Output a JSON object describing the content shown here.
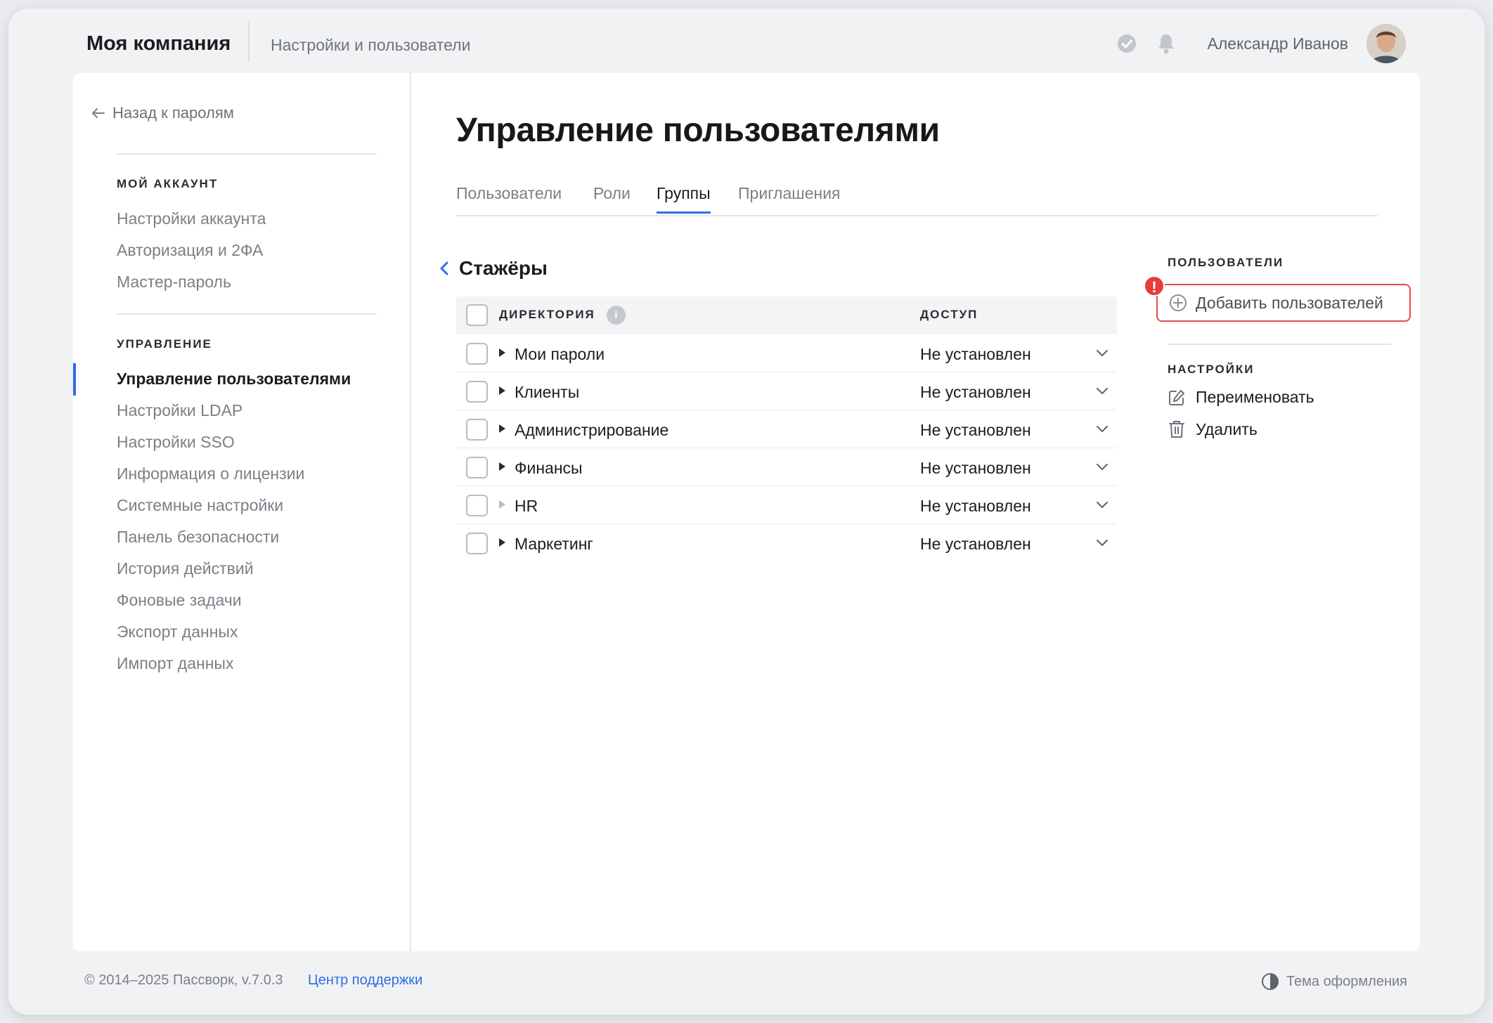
{
  "header": {
    "brand": "Моя компания",
    "subtitle": "Настройки и пользователи",
    "user_name": "Александр Иванов",
    "icons": [
      "check-circle-icon",
      "bell-icon"
    ]
  },
  "sidebar": {
    "back_label": "Назад к паролям",
    "section_account": "МОЙ АККАУНТ",
    "account_items": [
      "Настройки аккаунта",
      "Авторизация и 2ФА",
      "Мастер-пароль"
    ],
    "section_manage": "УПРАВЛЕНИЕ",
    "manage_items": [
      {
        "label": "Управление пользователями",
        "active": true
      },
      {
        "label": "Настройки LDAP",
        "active": false
      },
      {
        "label": "Настройки SSO",
        "active": false
      },
      {
        "label": "Информация о лицензии",
        "active": false
      },
      {
        "label": "Системные настройки",
        "active": false
      },
      {
        "label": "Панель безопасности",
        "active": false
      },
      {
        "label": "История действий",
        "active": false
      },
      {
        "label": "Фоновые задачи",
        "active": false
      },
      {
        "label": "Экспорт данных",
        "active": false
      },
      {
        "label": "Импорт данных",
        "active": false
      }
    ]
  },
  "main": {
    "title": "Управление пользователями",
    "tabs": [
      {
        "label": "Пользователи",
        "active": false
      },
      {
        "label": "Роли",
        "active": false
      },
      {
        "label": "Группы",
        "active": true
      },
      {
        "label": "Приглашения",
        "active": false
      }
    ],
    "group_name": "Стажёры",
    "table": {
      "col_directory": "ДИРЕКТОРИЯ",
      "col_access": "ДОСТУП",
      "info_mark": "i",
      "rows": [
        {
          "name": "Мои пароли",
          "access": "Не установлен",
          "expandable": true
        },
        {
          "name": "Клиенты",
          "access": "Не установлен",
          "expandable": true
        },
        {
          "name": "Администрирование",
          "access": "Не установлен",
          "expandable": true
        },
        {
          "name": "Финансы",
          "access": "Не установлен",
          "expandable": true
        },
        {
          "name": "HR",
          "access": "Не установлен",
          "expandable": false
        },
        {
          "name": "Маркетинг",
          "access": "Не установлен",
          "expandable": true
        }
      ]
    }
  },
  "right_panel": {
    "users_heading": "ПОЛЬЗОВАТЕЛИ",
    "add_users_label": "Добавить пользователей",
    "alert_mark": "!",
    "settings_heading": "НАСТРОЙКИ",
    "rename_label": "Переименовать",
    "delete_label": "Удалить"
  },
  "footer": {
    "copyright": "© 2014–2025 Пассворк, v.7.0.3",
    "support_link": "Центр поддержки",
    "theme_label": "Тема оформления"
  },
  "colors": {
    "accent": "#2f6fe0",
    "alert": "#e33d3d"
  }
}
